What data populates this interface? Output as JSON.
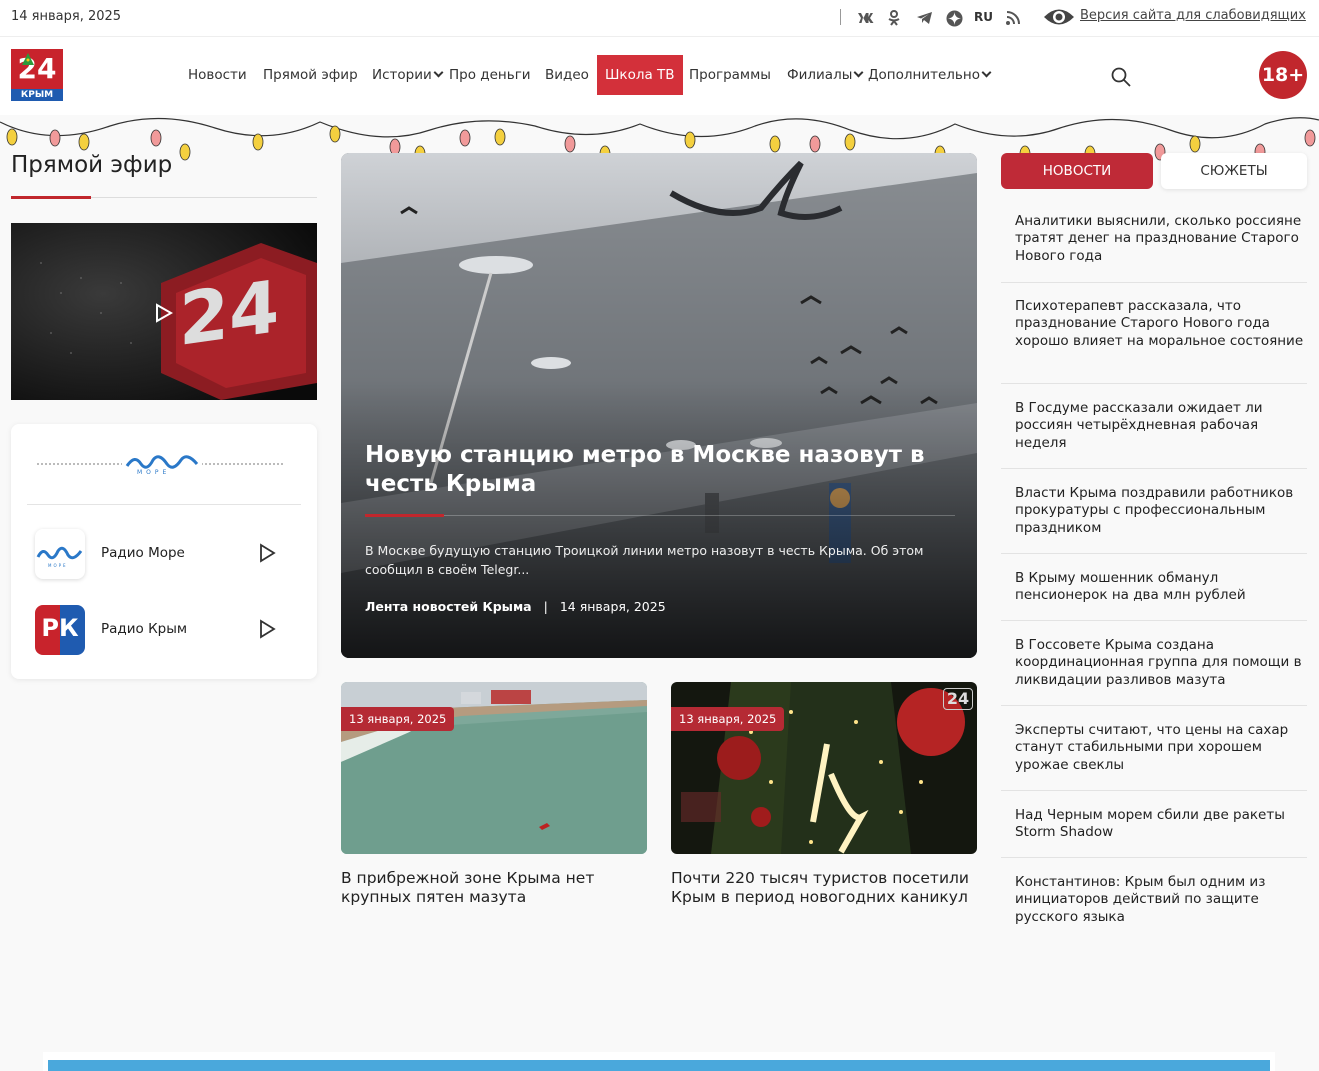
{
  "topbar": {
    "date": "14 января, 2025",
    "language": "RU",
    "vision_link": "Версия сайта для слабовидящих",
    "social_icons": [
      "vk-icon",
      "ok-icon",
      "telegram-icon",
      "dzen-icon",
      "rss-icon"
    ]
  },
  "header": {
    "logo_number": "24",
    "logo_sub": "КРЫМ",
    "age_badge": "18+",
    "nav": [
      {
        "label": "Новости"
      },
      {
        "label": "Прямой эфир"
      },
      {
        "label": "Истории"
      },
      {
        "label": "Про деньги"
      },
      {
        "label": "Видео"
      },
      {
        "label": "Школа ТВ"
      },
      {
        "label": "Программы"
      },
      {
        "label": "Филиалы"
      },
      {
        "label": "Дополнительно"
      }
    ]
  },
  "live": {
    "title": "Прямой эфир",
    "player_logo": "24"
  },
  "radio": {
    "brand": "МОРЕ",
    "stations": [
      {
        "name": "Радио Море",
        "icon_text": "МОРЕ"
      },
      {
        "name": "Радио Крым",
        "icon_text": "РК"
      }
    ]
  },
  "hero": {
    "title": "Новую станцию метро в Москве назовут в честь Крыма",
    "text": "В Москве будущую станцию Троицкой линии метро назовут в честь Крыма. Об этом сообщил в своём Telegr...",
    "source": "Лента новостей Крыма",
    "separator": "|",
    "date": "14 января, 2025"
  },
  "cards": [
    {
      "date": "13 января, 2025",
      "title": "В прибрежной зоне Крыма нет крупных пятен мазута"
    },
    {
      "date": "13 января, 2025",
      "title": "Почти 220 тысяч туристов посетили Крым в период новогодних каникул",
      "watermark": "24"
    }
  ],
  "right": {
    "tab_news": "НОВОСТИ",
    "tab_stories": "СЮЖЕТЫ",
    "news": [
      "Аналитики выяснили, сколько россияне тратят денег на празднование Старого Нового года",
      "Психотерапевт рассказала, что празднование Старого Нового года хорошо влияет на моральное состояние",
      "В Госдуме рассказали ожидает ли россиян четырёхдневная рабочая неделя",
      "Власти Крыма поздравили работников прокуратуры с профессиональным праздником",
      "В Крыму мошенник обманул пенсионерок на два млн рублей",
      "В Госсовете Крыма создана координационная группа для помощи в ликвидации разливов мазута",
      "Эксперты считают, что цены на сахар станут стабильными при хорошем урожае свеклы",
      "Над Черным морем сбили две ракеты Storm Shadow",
      "Константинов: Крым был одним из инициаторов действий по защите русского языка"
    ]
  },
  "colors": {
    "accent": "#c1272d",
    "active_nav": "#d3303a",
    "radio_blue": "#2a78c8",
    "banner": "#4aa8dc"
  }
}
